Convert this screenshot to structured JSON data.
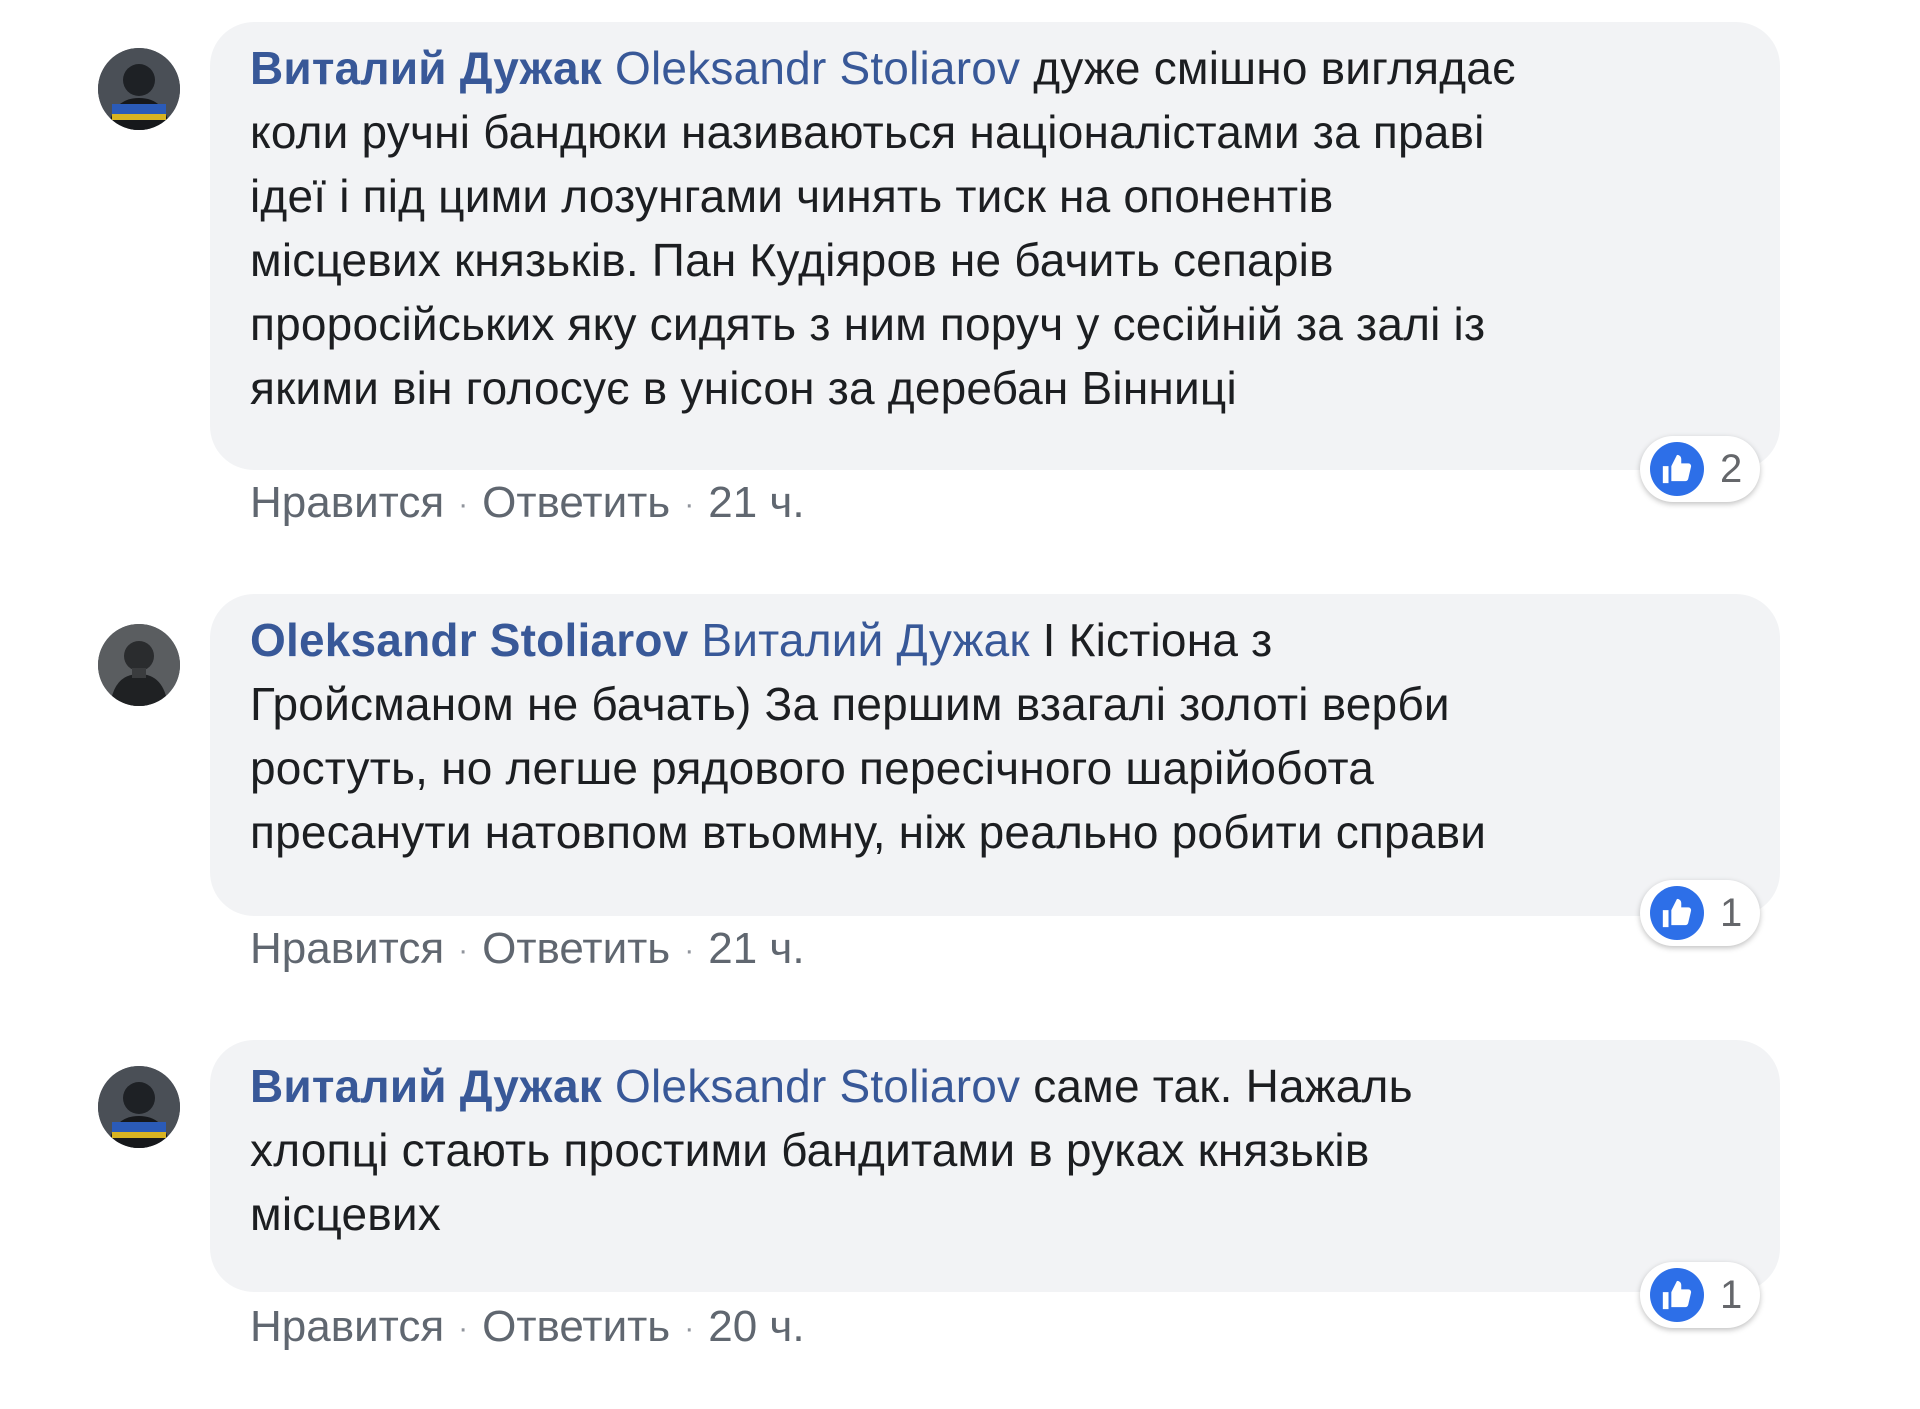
{
  "comments": [
    {
      "author": "Виталий Дужак",
      "mention": "Oleksandr Stoliarov",
      "lines": [
        "дуже смішно виглядає",
        "коли ручні бандюки називаються націоналістами за праві",
        "ідеї і під цими лозунгами чинять тиск на опонентів",
        "місцевих князьків. Пан Кудіяров не бачить сепарів",
        "проросійських яку сидять з ним поруч у сесійній за залі із",
        "якими він голосує в унісон за деребан Вінниці"
      ],
      "likes": "2",
      "like_label": "Нравится",
      "reply_label": "Ответить",
      "time": "21 ч."
    },
    {
      "author": "Oleksandr Stoliarov",
      "mention": "Виталий Дужак",
      "lines": [
        "І Кістіона з",
        "Гройсманом не бачать) За першим взагалі золоті верби",
        "ростуть, но легше рядового пересічного шарійобота",
        "пресанути натовпом втьомну, ніж реально робити справи"
      ],
      "likes": "1",
      "like_label": "Нравится",
      "reply_label": "Ответить",
      "time": "21 ч."
    },
    {
      "author": "Виталий Дужак",
      "mention": "Oleksandr Stoliarov",
      "lines": [
        "саме так. Нажаль",
        "хлопці стають простими бандитами в руках князьків",
        "місцевих"
      ],
      "likes": "1",
      "like_label": "Нравится",
      "reply_label": "Ответить",
      "time": "20 ч."
    }
  ],
  "separator": "·",
  "colors": {
    "author": "#385898",
    "bubble": "#f2f3f5",
    "like_blue": "#2d6fe8",
    "meta_text": "#606770"
  },
  "icons": {
    "like": "thumbs-up-icon",
    "avatar": "user-avatar"
  }
}
